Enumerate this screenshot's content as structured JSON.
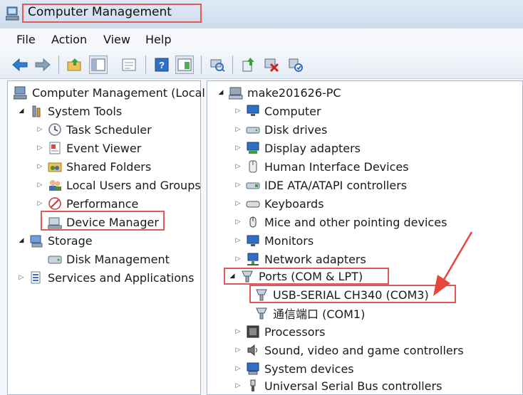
{
  "window": {
    "title": "Computer Management"
  },
  "menu": [
    "File",
    "Action",
    "View",
    "Help"
  ],
  "left_tree": {
    "root": "Computer Management (Local",
    "system_tools": "System Tools",
    "task_scheduler": "Task Scheduler",
    "event_viewer": "Event Viewer",
    "shared_folders": "Shared Folders",
    "local_users": "Local Users and Groups",
    "performance": "Performance",
    "device_manager": "Device Manager",
    "storage": "Storage",
    "disk_management": "Disk Management",
    "services": "Services and Applications"
  },
  "right_tree": {
    "root": "make201626-PC",
    "computer": "Computer",
    "disk_drives": "Disk drives",
    "display_adapters": "Display adapters",
    "hid": "Human Interface Devices",
    "ide": "IDE ATA/ATAPI controllers",
    "keyboards": "Keyboards",
    "mice": "Mice and other pointing devices",
    "monitors": "Monitors",
    "network": "Network adapters",
    "ports": "Ports (COM & LPT)",
    "usb_serial": "USB-SERIAL CH340 (COM3)",
    "com1": "通信端口 (COM1)",
    "processors": "Processors",
    "sound": "Sound, video and game controllers",
    "system_devices": "System devices",
    "usb_controllers": "Universal Serial Bus controllers"
  },
  "colors": {
    "highlight": "#e05a5a",
    "arrow": "#e8453c",
    "accent": "#2f6fc4"
  }
}
